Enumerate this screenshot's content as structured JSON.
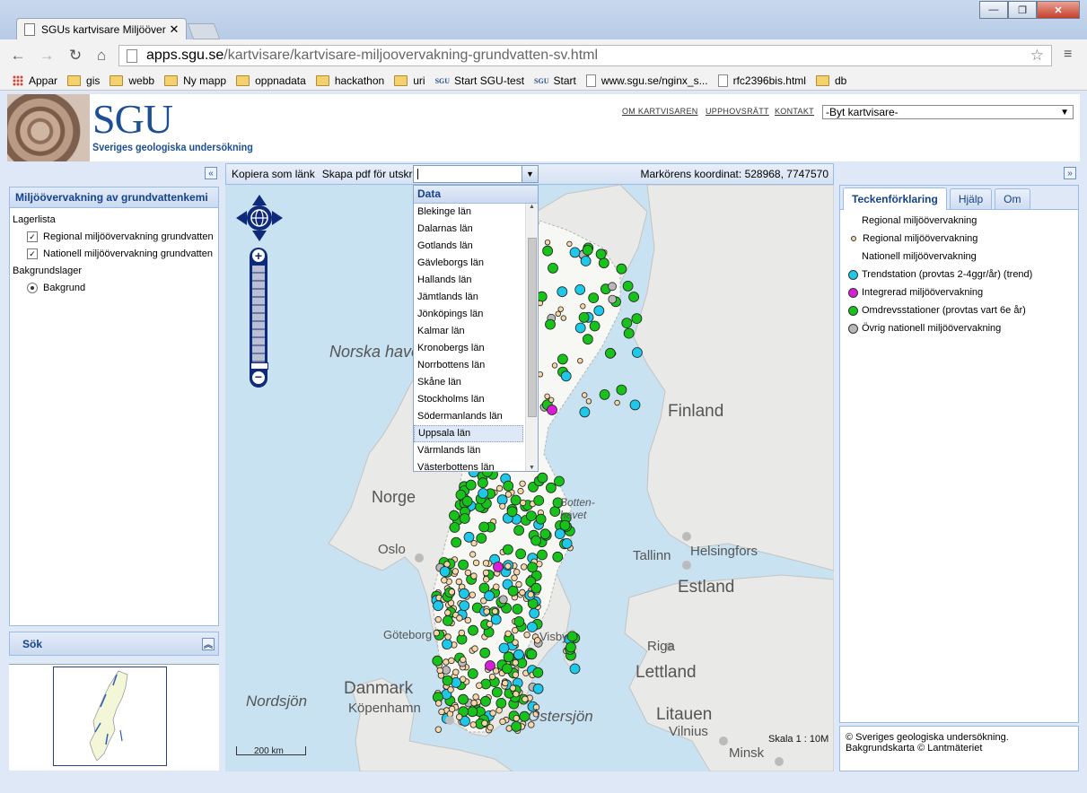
{
  "browser": {
    "tab_title": "SGUs kartvisare Miljööver",
    "url_host": "apps.sgu.se",
    "url_path": "/kartvisare/kartvisare-miljoovervakning-grundvatten-sv.html",
    "window_controls": {
      "minimize": "—",
      "maximize": "❐",
      "close": "✕"
    },
    "bookmarks": [
      {
        "label": "Appar",
        "icon": "apps-icon"
      },
      {
        "label": "gis",
        "icon": "folder-icon"
      },
      {
        "label": "webb",
        "icon": "folder-icon"
      },
      {
        "label": "Ny mapp",
        "icon": "folder-icon"
      },
      {
        "label": "oppnadata",
        "icon": "folder-icon"
      },
      {
        "label": "hackathon",
        "icon": "folder-icon"
      },
      {
        "label": "uri",
        "icon": "folder-icon"
      },
      {
        "label": "Start SGU-test",
        "icon": "sgu-favicon-icon"
      },
      {
        "label": "Start",
        "icon": "sgu-favicon-icon"
      },
      {
        "label": "www.sgu.se/nginx_s...",
        "icon": "page-icon"
      },
      {
        "label": "rfc2396bis.html",
        "icon": "page-icon"
      },
      {
        "label": "db",
        "icon": "folder-icon"
      }
    ]
  },
  "header": {
    "logo_text": "SGU",
    "logo_subtitle": "Sveriges geologiska undersökning",
    "links": [
      "OM KARTVISAREN",
      "UPPHOVSRÄTT",
      "KONTAKT"
    ],
    "viewer_select": "-Byt kartvisare-"
  },
  "left_panel": {
    "title": "Miljöövervakning av grundvattenkemi",
    "layer_list_label": "Lagerlista",
    "layers": [
      {
        "label": "Regional miljöövervakning grundvatten",
        "checked": true
      },
      {
        "label": "Nationell miljöövervakning grundvatten",
        "checked": true
      }
    ],
    "background_label": "Bakgrundslager",
    "background_option": "Bakgrund",
    "search_title": "Sök"
  },
  "map_toolbar": {
    "copy_link": "Kopiera som länk",
    "make_pdf": "Skapa pdf för utskrift",
    "coordinate_label": "Markörens koordinat:",
    "coordinate_value": "528968, 7747570"
  },
  "dropdown": {
    "header": "Data",
    "items": [
      "Blekinge län",
      "Dalarnas län",
      "Gotlands län",
      "Gävleborgs län",
      "Hallands län",
      "Jämtlands län",
      "Jönköpings län",
      "Kalmar län",
      "Kronobergs län",
      "Norrbottens län",
      "Skåne län",
      "Stockholms län",
      "Södermanlands län",
      "Uppsala län",
      "Värmlands län",
      "Västerbottens län"
    ],
    "selected": "Uppsala län"
  },
  "map": {
    "labels": {
      "norska_havet": "Norska havet",
      "finland": "Finland",
      "norge": "Norge",
      "bottenhavet": "Botten-\nhavet",
      "oslo": "Oslo",
      "tallinn": "Tallinn",
      "helsingfors": "Helsingfors",
      "estland": "Estland",
      "goteborg": "Göteborg",
      "visby": "Visby",
      "riga": "Riga",
      "lettland": "Lettland",
      "danmark": "Danmark",
      "kopenhamn": "Köpenhamn",
      "nordsjon": "Nordsjön",
      "ostersjon": "Östersjön",
      "litauen": "Litauen",
      "vilnius": "Vilnius",
      "minsk": "Minsk"
    },
    "scalebar_label": "200 km",
    "scale_text": "Skala 1 : 10M"
  },
  "right_panel": {
    "tabs": [
      "Teckenförklaring",
      "Hjälp",
      "Om"
    ],
    "active_tab": "Teckenförklaring",
    "legend": [
      {
        "label": "Regional miljöövervakning",
        "symbol": "none",
        "color": ""
      },
      {
        "label": "Regional miljöövervakning",
        "symbol": "small",
        "color": "#f5d7a8"
      },
      {
        "label": "Nationell miljöövervakning",
        "symbol": "none",
        "color": ""
      },
      {
        "label": "Trendstation (provtas 2-4ggr/år) (trend)",
        "symbol": "circle",
        "color": "#1ec8e8"
      },
      {
        "label": "Integrerad miljöövervakning",
        "symbol": "circle",
        "color": "#d81fd6"
      },
      {
        "label": "Omdrevsstationer (provtas vart 6e år)",
        "symbol": "circle",
        "color": "#17c21a"
      },
      {
        "label": "Övrig nationell miljöövervakning",
        "symbol": "circle",
        "color": "#b8b8b8"
      }
    ],
    "footer_line1": "© Sveriges geologiska undersökning.",
    "footer_line2": "Bakgrundskarta © Lantmäteriet"
  },
  "colors": {
    "panel_bg": "#dfe8f6",
    "panel_border": "#99bbe8",
    "header_text": "#15428b",
    "sea": "#c9e2f1",
    "land": "#e9e9e7"
  }
}
